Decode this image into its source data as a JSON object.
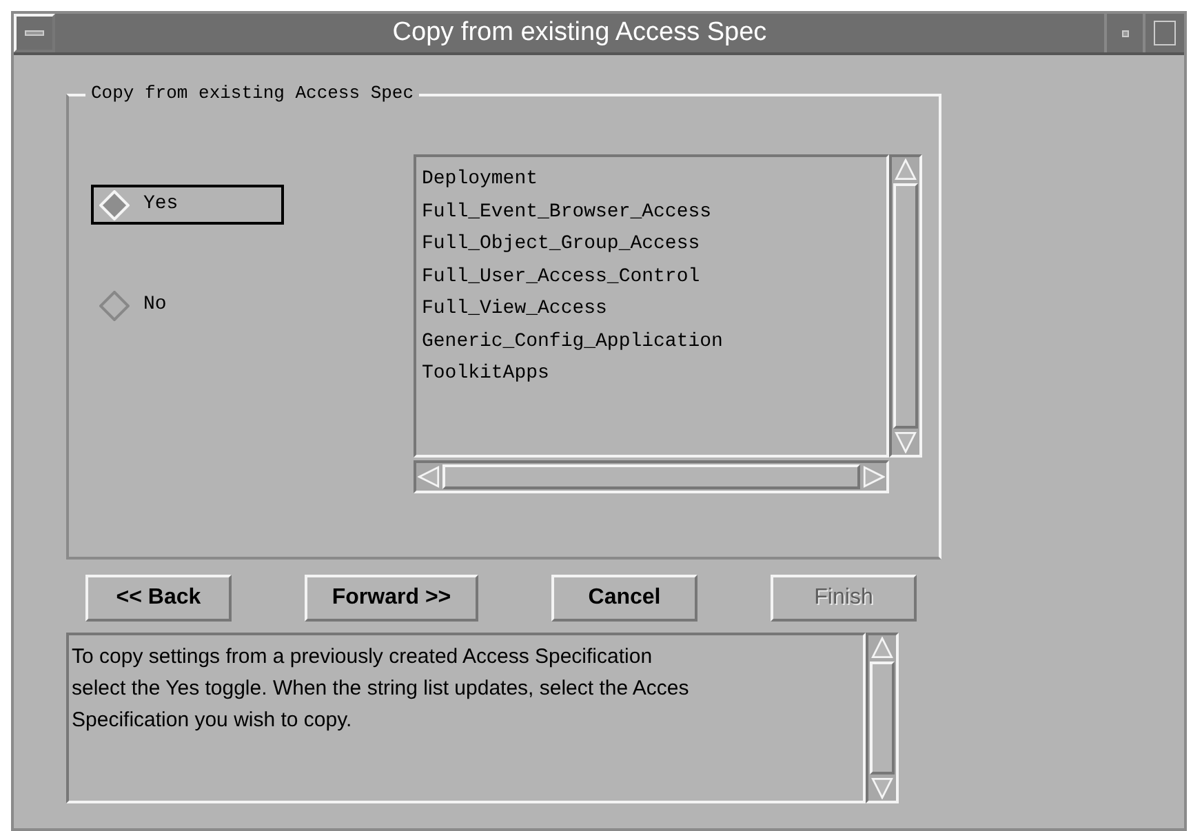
{
  "window": {
    "title": "Copy from existing Access Spec"
  },
  "group": {
    "label": "Copy from existing Access Spec"
  },
  "options": [
    {
      "label": "Yes",
      "selected": true,
      "focused": true
    },
    {
      "label": "No",
      "selected": false,
      "focused": false
    }
  ],
  "list": {
    "items": [
      "Deployment",
      "Full_Event_Browser_Access",
      "Full_Object_Group_Access",
      "Full_User_Access_Control",
      "Full_View_Access",
      "Generic_Config_Application",
      "ToolkitApps"
    ]
  },
  "buttons": [
    {
      "label": "<< Back",
      "disabled": false
    },
    {
      "label": "Forward >>",
      "disabled": false
    },
    {
      "label": "Cancel",
      "disabled": false
    },
    {
      "label": "Finish",
      "disabled": true
    }
  ],
  "help": {
    "lines": [
      "To copy settings from a previously created Access Specification",
      "select the Yes toggle. When the string list updates, select the Acces",
      "Specification you wish to copy."
    ]
  }
}
